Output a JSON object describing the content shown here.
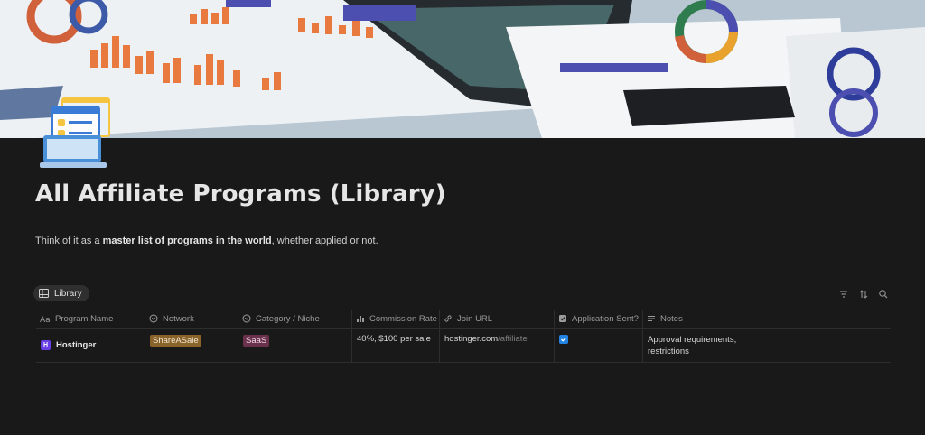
{
  "page": {
    "title": "All Affiliate Programs (Library)",
    "description_prefix": "Think of it as a ",
    "description_bold": "master list of programs in the world",
    "description_suffix": ", whether applied or not.",
    "icon": "checklist-laptop-icon",
    "cover": "analytics-charts-photo"
  },
  "view": {
    "tab_label": "Library",
    "tab_icon": "table-icon",
    "tools": [
      "filter-icon",
      "sort-icon",
      "search-icon"
    ]
  },
  "table": {
    "columns": [
      {
        "label": "Program Name",
        "icon": "title-aa-icon"
      },
      {
        "label": "Network",
        "icon": "select-icon"
      },
      {
        "label": "Category / Niche",
        "icon": "select-icon"
      },
      {
        "label": "Commission Rate",
        "icon": "bar-chart-icon"
      },
      {
        "label": "Join URL",
        "icon": "link-icon"
      },
      {
        "label": "Application Sent?",
        "icon": "checkbox-icon"
      },
      {
        "label": "Notes",
        "icon": "text-lines-icon"
      }
    ],
    "rows": [
      {
        "program_name": "Hostinger",
        "program_icon_letter": "H",
        "network": "ShareASale",
        "category": "SaaS",
        "commission_rate": "40%, $100 per sale",
        "join_url_domain": "hostinger.com",
        "join_url_path": "/affiliate",
        "application_sent": true,
        "notes_line1": "Approval requirements,",
        "notes_line2": "restrictions"
      }
    ]
  },
  "colors": {
    "background": "#191919",
    "network_tag": "#89632a",
    "category_tag": "#69314c",
    "checkbox": "#2383e2",
    "hostinger_brand": "#673de6"
  }
}
